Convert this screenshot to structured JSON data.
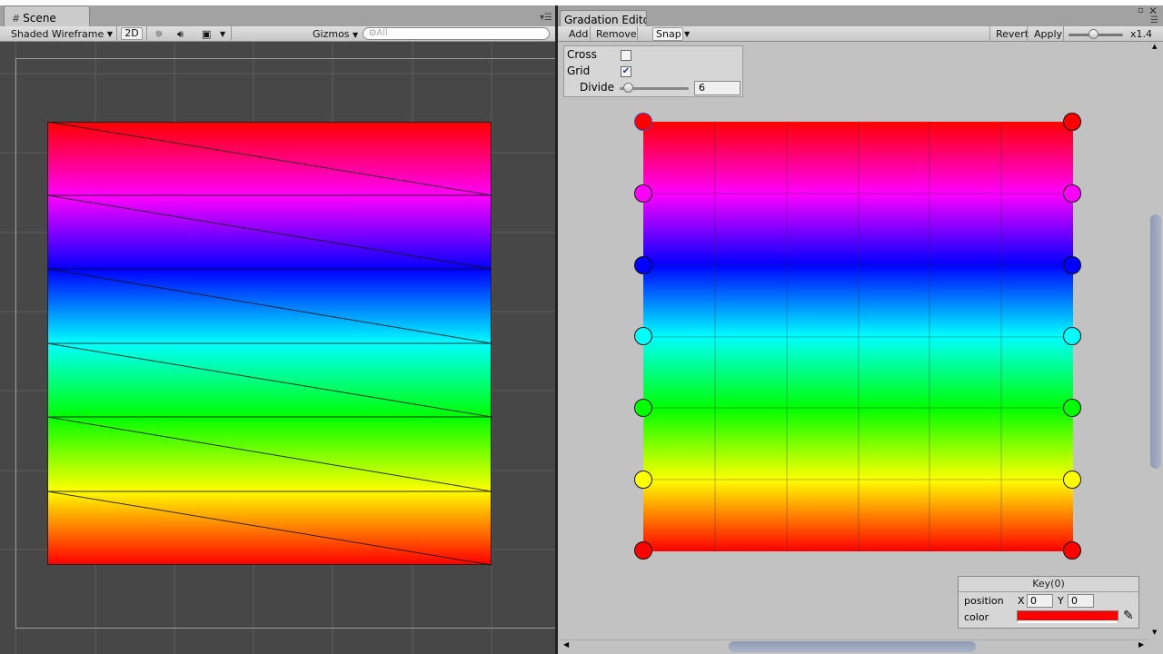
{
  "scene": {
    "tab_label": "Scene",
    "shading_mode": "Shaded Wireframe",
    "mode_2d": "2D",
    "gizmos_label": "Gizmos",
    "search_placeholder": "All"
  },
  "editor": {
    "tab_label": "Gradation Editc",
    "toolbar": {
      "add": "Add",
      "remove": "Remove",
      "snap": "Snap",
      "revert": "Revert",
      "apply": "Apply",
      "zoom": "x1.4"
    },
    "settings": {
      "cross_label": "Cross",
      "cross_checked": false,
      "grid_label": "Grid",
      "grid_checked": true,
      "divide_label": "Divide",
      "divide_value": "6"
    },
    "key_panel": {
      "title": "Key(0)",
      "position_label": "position",
      "x_label": "X",
      "x_value": "0",
      "y_label": "Y",
      "y_value": "0",
      "color_label": "color",
      "color_value": "#ff0000"
    },
    "gradient_keys": [
      "#ff0000",
      "#ff00ff",
      "#0000ff",
      "#00ffff",
      "#00ff00",
      "#ffff00",
      "#ff0000"
    ]
  },
  "icons": {
    "scene_tab": "grid-icon",
    "lighting": "sun-icon",
    "audio": "speaker-icon",
    "effects": "image-icon",
    "search": "search-icon",
    "eyedropper": "eyedropper-icon",
    "close": "close-icon",
    "maximize": "maximize-icon"
  }
}
